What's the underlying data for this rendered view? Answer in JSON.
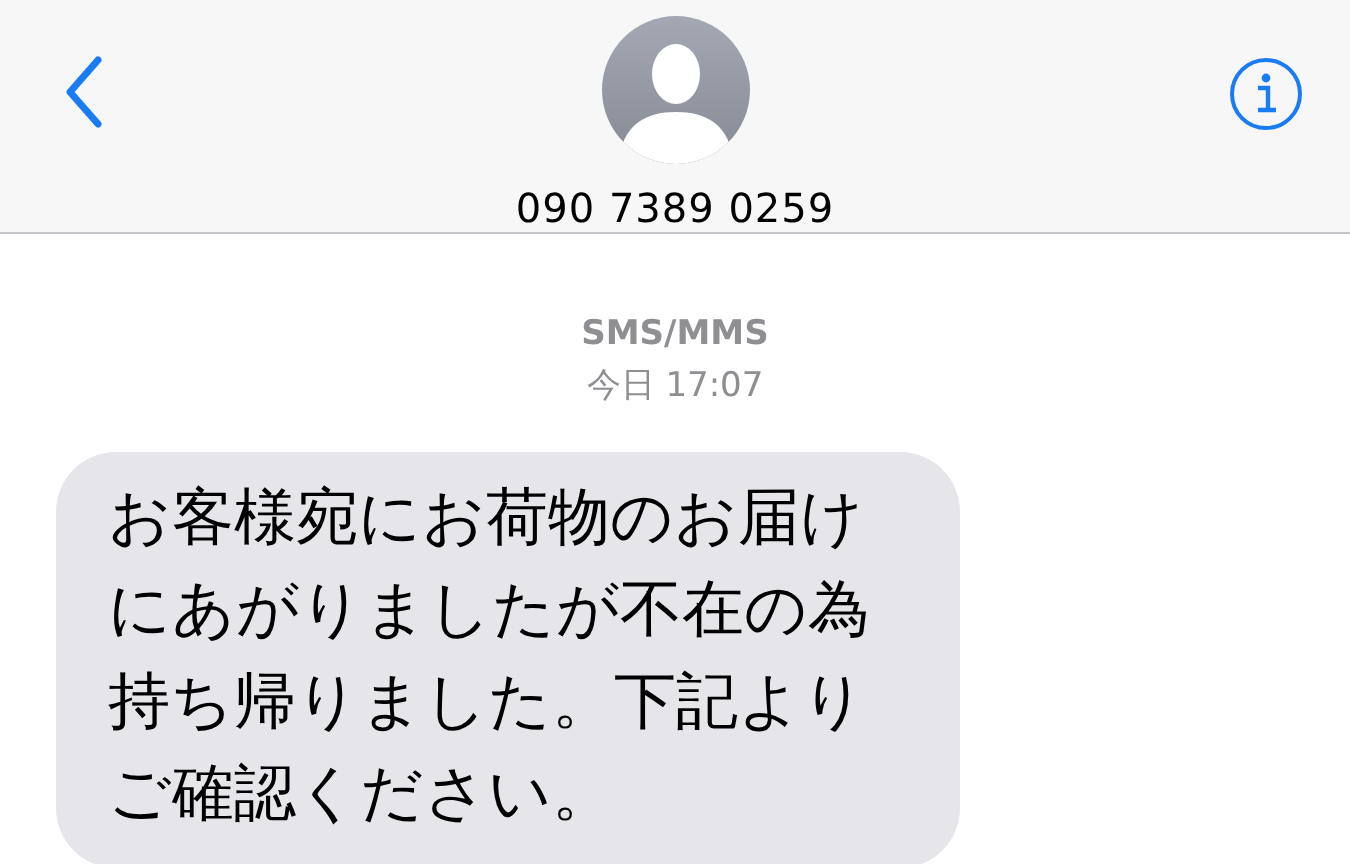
{
  "header": {
    "contact": "090 7389 0259"
  },
  "thread": {
    "service": "SMS/MMS",
    "timestamp": "今日 17:07"
  },
  "messages": [
    {
      "kind": "incoming",
      "text": "お客様宛にお荷物のお届けにあがりましたが不在の為持ち帰りました。下記よりご確認ください。"
    }
  ]
}
